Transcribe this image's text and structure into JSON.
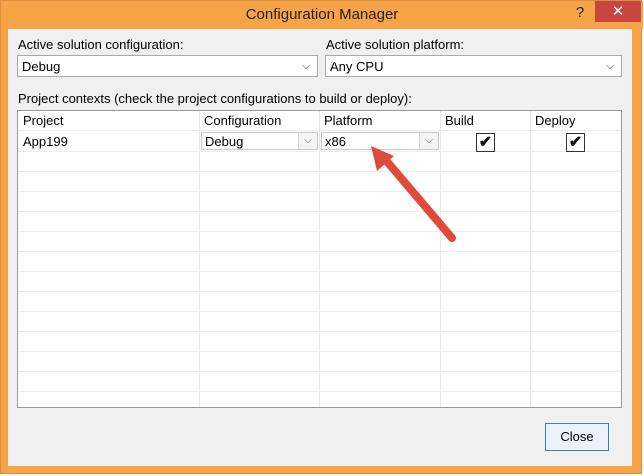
{
  "window": {
    "title": "Configuration Manager",
    "help_glyph": "?",
    "close_glyph": "✕"
  },
  "active_config": {
    "label": "Active solution configuration:",
    "value": "Debug"
  },
  "active_platform": {
    "label": "Active solution platform:",
    "value": "Any CPU"
  },
  "contexts": {
    "label": "Project contexts (check the project configurations to build or deploy):",
    "columns": [
      "Project",
      "Configuration",
      "Platform",
      "Build",
      "Deploy"
    ],
    "rows": [
      {
        "project": "App199",
        "configuration": "Debug",
        "platform": "x86",
        "build": true,
        "deploy": true
      }
    ]
  },
  "buttons": {
    "close": "Close"
  },
  "icons": {
    "dropdown": "chevron-down-icon",
    "check": "checkmark-icon"
  },
  "colors": {
    "titlebar": "#f7a347",
    "close_button": "#c7463f",
    "annotation_arrow": "#e04a3a"
  }
}
